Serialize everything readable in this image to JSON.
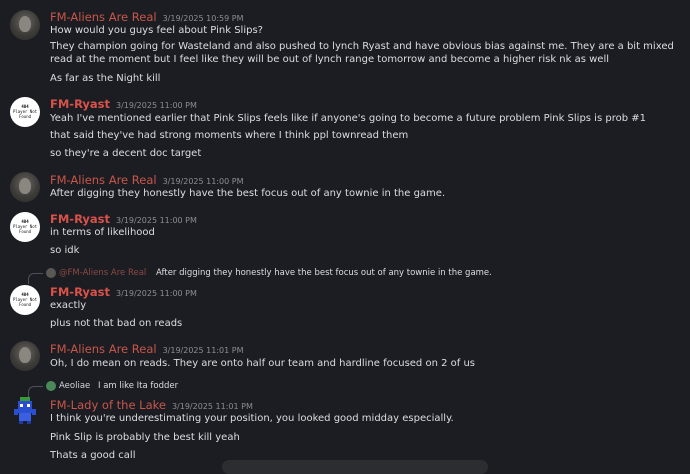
{
  "messages": [
    {
      "author": "FM-Aliens Are Real",
      "timestamp": "3/19/2025 10:59 PM",
      "lines": [
        "How would you guys feel about Pink Slips?",
        "They champion going for Wasteland and also pushed to lynch Ryast and have obvious bias against me. They are a bit mixed read at the moment but I feel like they will be out of lynch range tomorrow and become a higher risk nk as well",
        "As far as the Night kill"
      ]
    },
    {
      "author": "FM-Ryast",
      "timestamp": "3/19/2025 11:00 PM",
      "avatar_text": [
        "404",
        "Player Not",
        "Found"
      ],
      "lines": [
        "Yeah I've mentioned earlier that Pink Slips feels like if anyone's going to become a future problem Pink Slips is prob #1",
        "that said they've had strong moments where I think ppl townread them",
        "so they're a decent doc target"
      ]
    },
    {
      "author": "FM-Aliens Are Real",
      "timestamp": "3/19/2025 11:00 PM",
      "lines": [
        "After digging they honestly have the best focus out of any townie in the game."
      ]
    },
    {
      "author": "FM-Ryast",
      "timestamp": "3/19/2025 11:00 PM",
      "avatar_text": [
        "404",
        "Player Not",
        "Found"
      ],
      "lines": [
        "in terms of likelihood",
        "so idk"
      ]
    },
    {
      "reply": {
        "name": "@FM-Aliens Are Real",
        "text": "After digging they honestly have the best focus out of any townie in the game."
      },
      "author": "FM-Ryast",
      "timestamp": "3/19/2025 11:00 PM",
      "avatar_text": [
        "404",
        "Player Not",
        "Found"
      ],
      "lines": [
        "exactly",
        "plus not that bad on reads"
      ]
    },
    {
      "author": "FM-Aliens Are Real",
      "timestamp": "3/19/2025 11:01 PM",
      "lines": [
        "Oh, I do mean on reads. They are onto half our team and hardline focused on 2 of us"
      ]
    },
    {
      "reply": {
        "name": "Aeoliae",
        "text": "I am like Ita fodder"
      },
      "author": "FM-Lady of the Lake",
      "timestamp": "3/19/2025 11:01 PM",
      "lines": [
        "I think you're underestimating your position, you looked good midday especially.",
        "Pink Slip is probably the best kill yeah",
        "Thats a good call"
      ]
    }
  ],
  "colors": {
    "background": "#1c1d22",
    "username": "#c8564b",
    "timestamp": "#8a8e94",
    "text": "#dbdee1"
  },
  "icons": {
    "aliens_avatar": "grey-alien-avatar",
    "ryast_avatar": "404-player-not-found-avatar",
    "lady_avatar": "blue-pixel-character-avatar"
  }
}
